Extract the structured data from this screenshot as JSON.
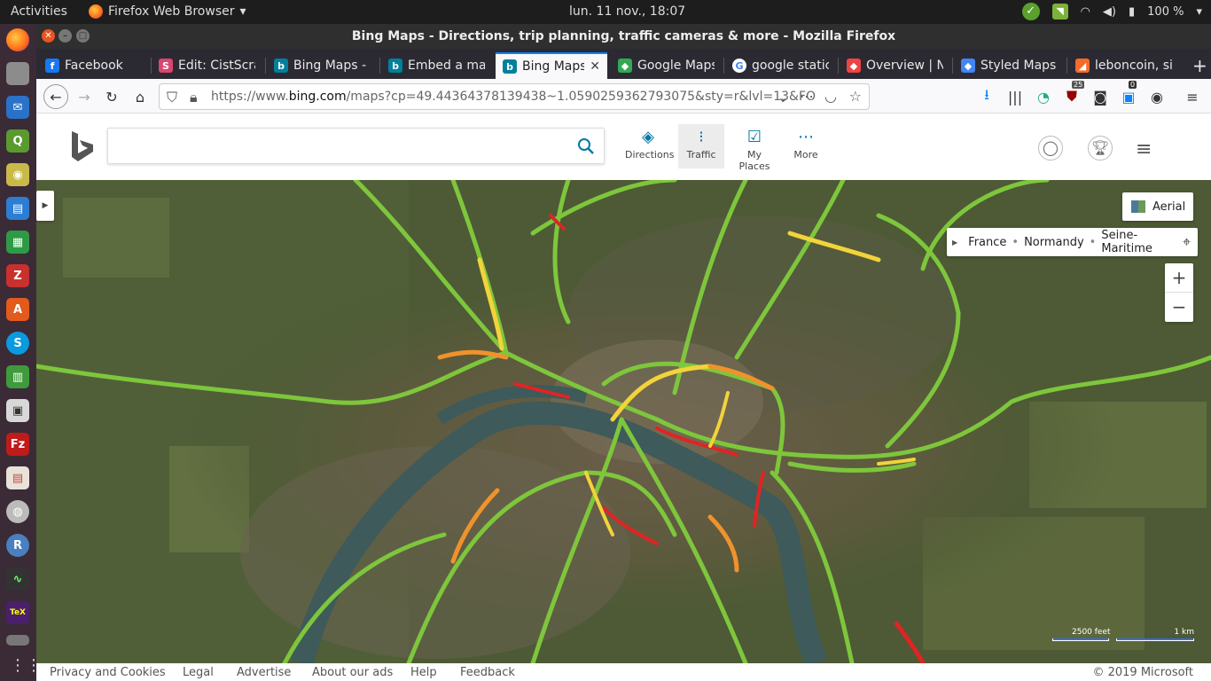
{
  "topbar": {
    "activities": "Activities",
    "app": "Firefox Web Browser",
    "clock": "lun. 11 nov., 18:07",
    "battery": "100 %"
  },
  "window_title": "Bing Maps - Directions, trip planning, traffic cameras & more - Mozilla Firefox",
  "tabs": [
    {
      "label": "Facebook",
      "fav": "f",
      "color": "#1877f2"
    },
    {
      "label": "Edit: CistScra",
      "fav": "S",
      "color": "#d9466f"
    },
    {
      "label": "Bing Maps - D",
      "fav": "b",
      "color": "#00809d"
    },
    {
      "label": "Embed a ma",
      "fav": "b",
      "color": "#00809d"
    },
    {
      "label": "Bing Maps",
      "fav": "b",
      "color": "#00809d"
    },
    {
      "label": "Google Maps",
      "fav": "◆",
      "color": "#34a853"
    },
    {
      "label": "google static",
      "fav": "G",
      "color": "#4285f4"
    },
    {
      "label": "Overview | N",
      "fav": "◆",
      "color": "#e44"
    },
    {
      "label": "Styled Maps",
      "fav": "◆",
      "color": "#4285f4"
    },
    {
      "label": "leboncoin, si",
      "fav": "◢",
      "color": "#f56b2a"
    }
  ],
  "url": {
    "prefix": "https://www.",
    "domain": "bing.com",
    "rest": "/maps?cp=49.44364378139438~1.0590259362793075&sty=r&lvl=13&FO"
  },
  "badges": {
    "ublock": "25",
    "count": "0"
  },
  "bing": {
    "directions": "Directions",
    "traffic": "Traffic",
    "myplaces": "My Places",
    "more": "More"
  },
  "map": {
    "aerial": "Aerial",
    "crumb1": "France",
    "crumb2": "Normandy",
    "crumb3": "Seine-Maritime",
    "zoom_in": "+",
    "zoom_out": "−",
    "scale1": "2500 feet",
    "scale2": "1 km"
  },
  "footer": {
    "privacy": "Privacy and Cookies",
    "legal": "Legal",
    "advertise": "Advertise",
    "about": "About our ads",
    "help": "Help",
    "feedback": "Feedback",
    "copyright": "© 2019 Microsoft"
  },
  "colors": {
    "traffic_green": "#7ec63c",
    "traffic_yellow": "#f2d33a",
    "traffic_orange": "#f0922b",
    "traffic_red": "#e02424",
    "accent": "#0a84ff"
  }
}
